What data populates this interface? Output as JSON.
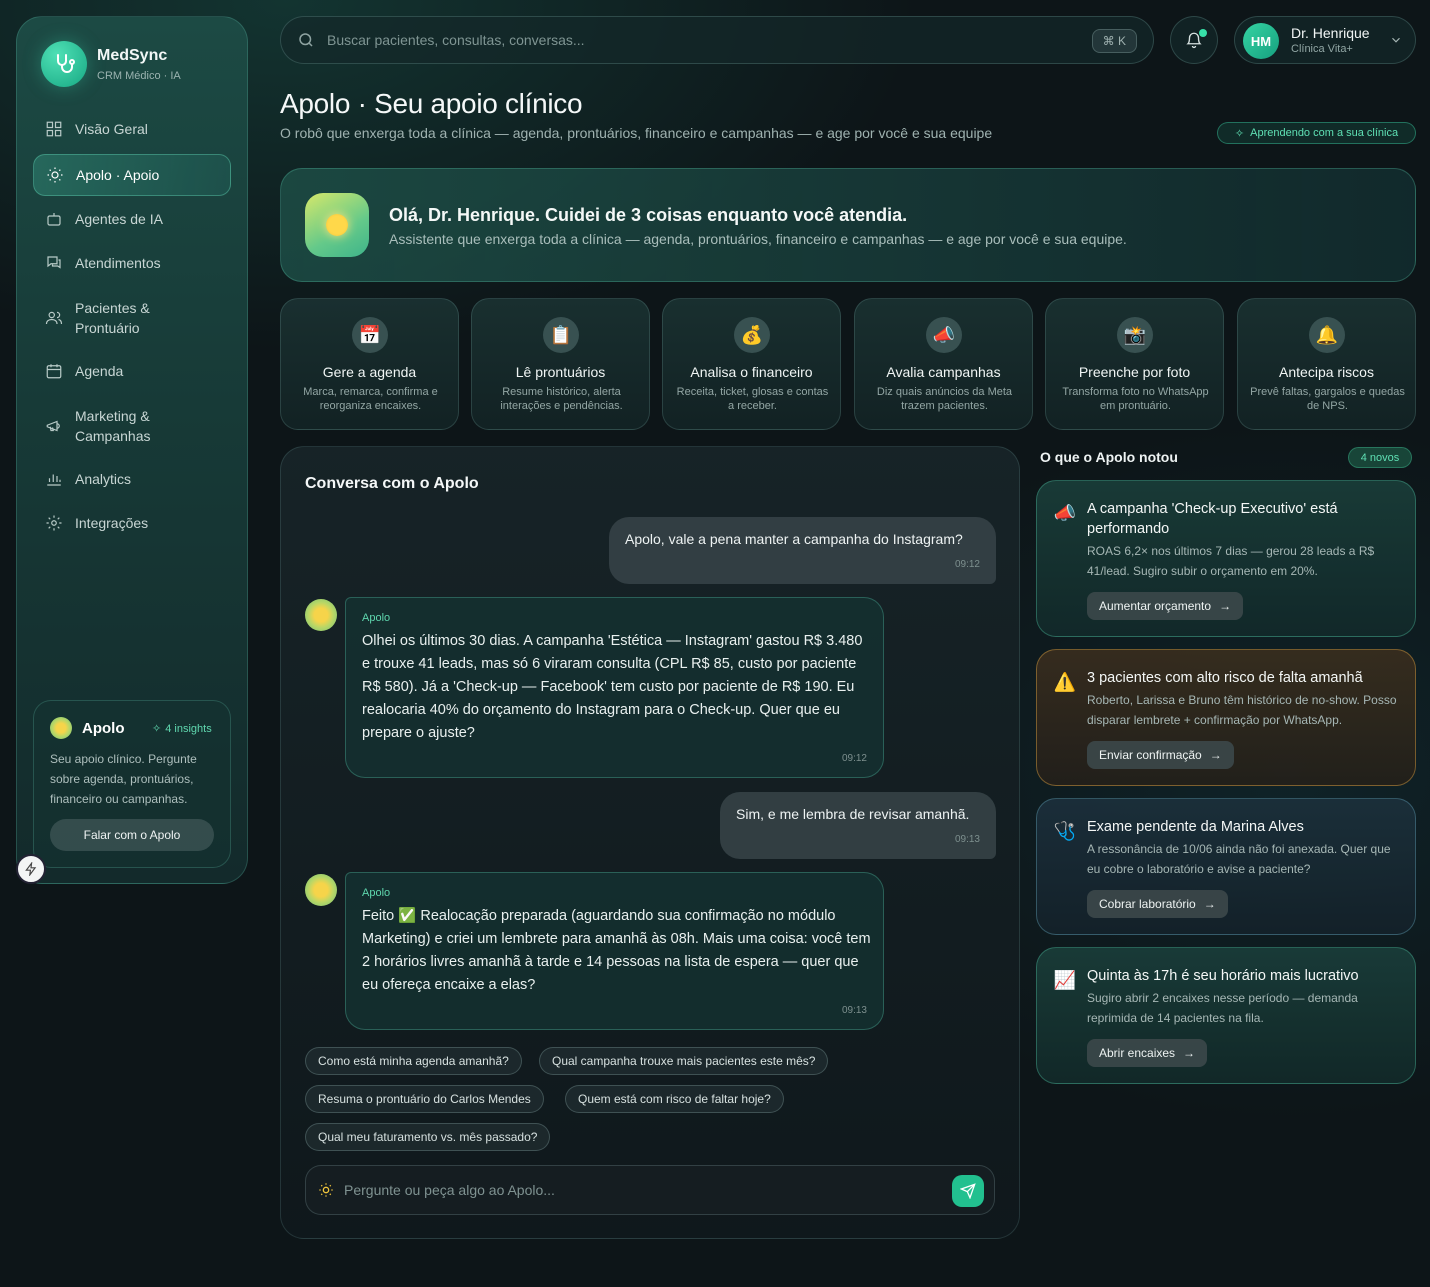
{
  "brand": {
    "name": "MedSync",
    "subtitle": "CRM Médico · IA"
  },
  "sidebar": {
    "items": [
      {
        "label": "Visão Geral",
        "icon": "grid-icon"
      },
      {
        "label": "Apolo · Apoio",
        "icon": "sun-icon",
        "active": true
      },
      {
        "label": "Agentes de IA",
        "icon": "robot-icon"
      },
      {
        "label": "Atendimentos",
        "icon": "chat-icon"
      },
      {
        "label": "Pacientes & Prontuário",
        "icon": "users-icon"
      },
      {
        "label": "Agenda",
        "icon": "calendar-icon"
      },
      {
        "label": "Marketing & Campanhas",
        "icon": "megaphone-icon"
      },
      {
        "label": "Analytics",
        "icon": "bar-chart-icon"
      },
      {
        "label": "Integrações",
        "icon": "gear-icon"
      }
    ],
    "apolo_card": {
      "title": "Apolo",
      "insights": "4 insights",
      "description": "Seu apoio clínico. Pergunte sobre agenda, prontuários, financeiro ou campanhas.",
      "button": "Falar com o Apolo"
    }
  },
  "topbar": {
    "search_placeholder": "Buscar pacientes, consultas, conversas...",
    "shortcut": "⌘ K",
    "user": {
      "initials": "HM",
      "name": "Dr. Henrique",
      "clinic": "Clínica Vita+"
    }
  },
  "header": {
    "title": "Apolo · Seu apoio clínico",
    "subtitle": "O robô que enxerga toda a clínica — agenda, prontuários, financeiro e campanhas — e age por você e sua equipe",
    "badge": "Aprendendo com a sua clínica"
  },
  "hero": {
    "title": "Olá, Dr. Henrique. Cuidei de 3 coisas enquanto você atendia.",
    "subtitle": "Assistente que enxerga toda a clínica — agenda, prontuários, financeiro e campanhas — e age por você e sua equipe."
  },
  "capabilities": [
    {
      "icon": "📅",
      "title": "Gere a agenda",
      "desc": "Marca, remarca, confirma e reorganiza encaixes."
    },
    {
      "icon": "📋",
      "title": "Lê prontuários",
      "desc": "Resume histórico, alerta interações e pendências."
    },
    {
      "icon": "💰",
      "title": "Analisa o financeiro",
      "desc": "Receita, ticket, glosas e contas a receber."
    },
    {
      "icon": "📣",
      "title": "Avalia campanhas",
      "desc": "Diz quais anúncios da Meta trazem pacientes."
    },
    {
      "icon": "📸",
      "title": "Preenche por foto",
      "desc": "Transforma foto no WhatsApp em prontuário."
    },
    {
      "icon": "🔔",
      "title": "Antecipa riscos",
      "desc": "Prevê faltas, gargalos e quedas de NPS."
    }
  ],
  "chat": {
    "title": "Conversa com o Apolo",
    "messages": [
      {
        "from": "user",
        "text": "Apolo, vale a pena manter a campanha do Instagram?",
        "time": "09:12"
      },
      {
        "from": "bot",
        "name": "Apolo",
        "text": "Olhei os últimos 30 dias. A campanha 'Estética — Instagram' gastou R$ 3.480 e trouxe 41 leads, mas só 6 viraram consulta (CPL R$ 85, custo por paciente R$ 580). Já a 'Check-up — Facebook' tem custo por paciente de R$ 190. Eu realocaria 40% do orçamento do Instagram para o Check-up. Quer que eu prepare o ajuste?",
        "time": "09:12"
      },
      {
        "from": "user",
        "text": "Sim, e me lembra de revisar amanhã.",
        "time": "09:13"
      },
      {
        "from": "bot",
        "name": "Apolo",
        "text": "Feito ✅ Realocação preparada (aguardando sua confirmação no módulo Marketing) e criei um lembrete para amanhã às 08h. Mais uma coisa: você tem 2 horários livres amanhã à tarde e 14 pessoas na lista de espera — quer que eu ofereça encaixe a elas?",
        "time": "09:13"
      }
    ],
    "suggestions": [
      "Como está minha agenda amanhã?",
      "Qual campanha trouxe mais pacientes este mês?",
      "Resuma o prontuário do Carlos Mendes",
      "Quem está com risco de faltar hoje?",
      "Qual meu faturamento vs. mês passado?"
    ],
    "input_placeholder": "Pergunte ou peça algo ao Apolo..."
  },
  "insights": {
    "title": "O que o Apolo notou",
    "badge": "4 novos",
    "items": [
      {
        "tone": "green",
        "icon": "📣",
        "title": "A campanha 'Check-up Executivo' está performando",
        "desc": "ROAS 6,2× nos últimos 7 dias — gerou 28 leads a R$ 41/lead. Sugiro subir o orçamento em 20%.",
        "action": "Aumentar orçamento"
      },
      {
        "tone": "amber",
        "icon": "⚠️",
        "title": "3 pacientes com alto risco de falta amanhã",
        "desc": "Roberto, Larissa e Bruno têm histórico de no-show. Posso disparar lembrete + confirmação por WhatsApp.",
        "action": "Enviar confirmação"
      },
      {
        "tone": "blue",
        "icon": "🩺",
        "title": "Exame pendente da Marina Alves",
        "desc": "A ressonância de 10/06 ainda não foi anexada. Quer que eu cobre o laboratório e avise a paciente?",
        "action": "Cobrar laboratório"
      },
      {
        "tone": "green",
        "icon": "📈",
        "title": "Quinta às 17h é seu horário mais lucrativo",
        "desc": "Sugiro abrir 2 encaixes nesse período — demanda reprimida de 14 pacientes na fila.",
        "action": "Abrir encaixes"
      }
    ]
  }
}
